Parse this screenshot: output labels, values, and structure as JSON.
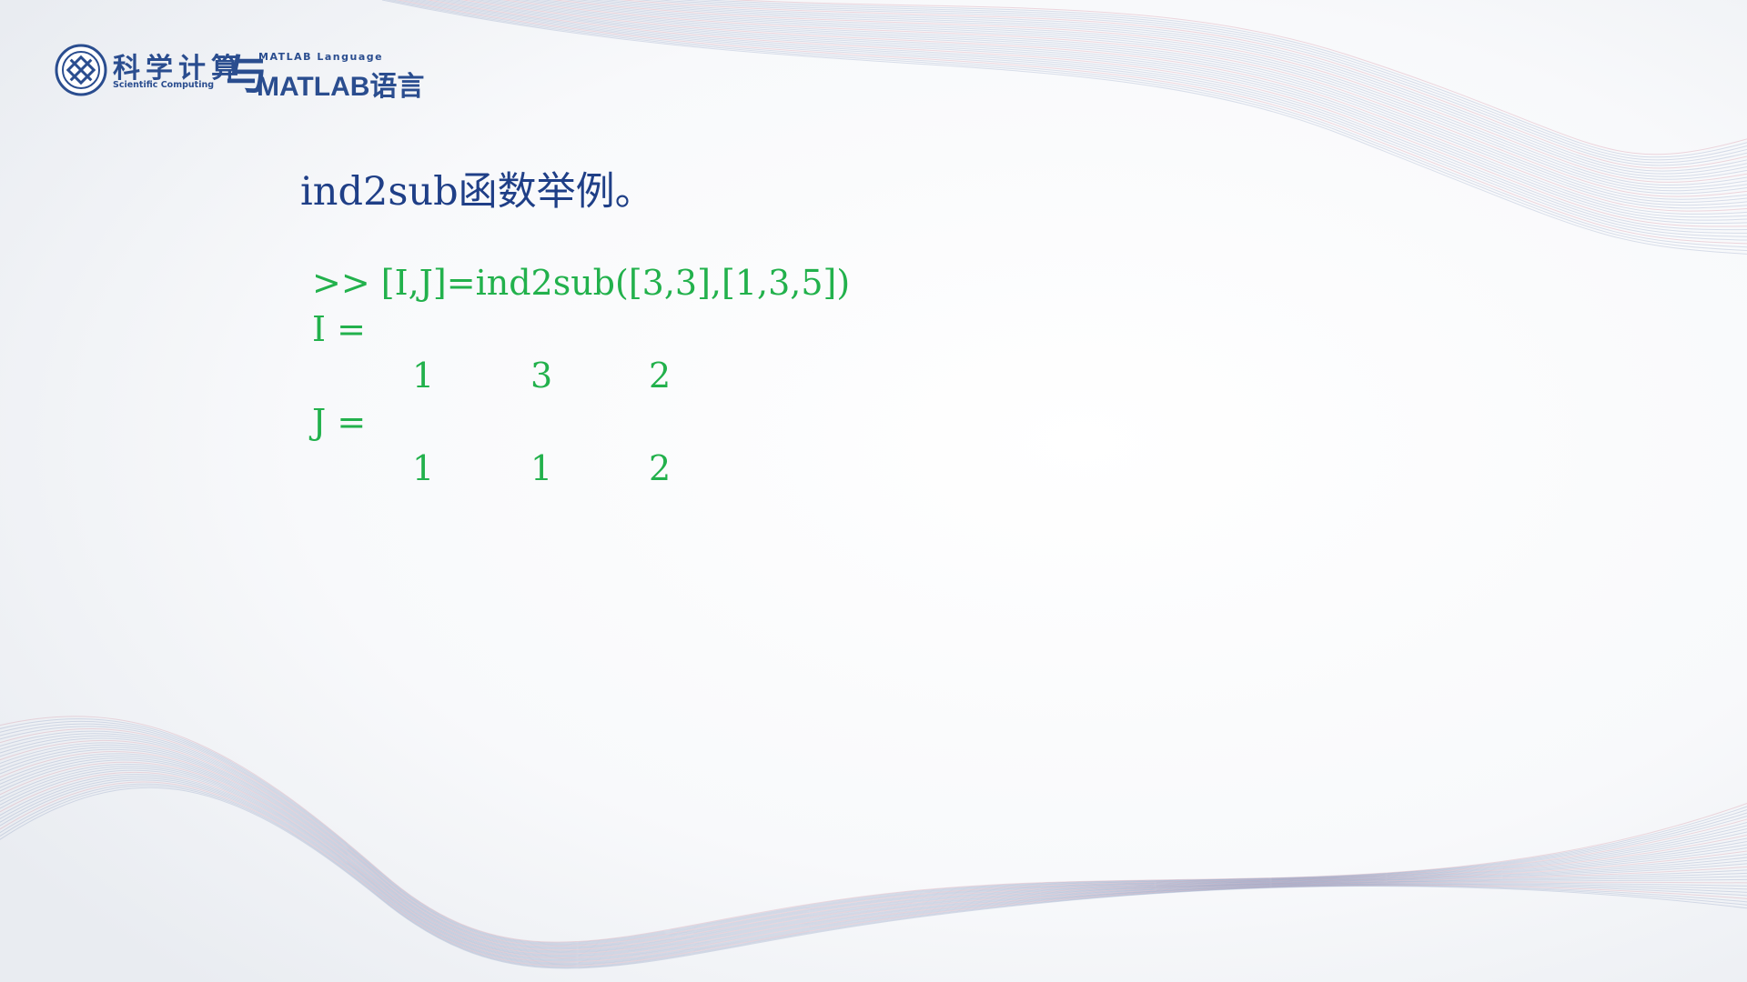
{
  "logo": {
    "title_cn": "科学计算",
    "title_en": "Scientific Computing",
    "connector": "与",
    "subtitle_en": "MATLAB Language",
    "subtitle_big": "MATLAB语言"
  },
  "slide": {
    "heading": "ind2sub函数举例。",
    "command": ">> [I,J]=ind2sub([3,3],[1,3,5])",
    "i_label": "I =",
    "i_values": [
      "1",
      "3",
      "2"
    ],
    "j_label": "J =",
    "j_values": [
      "1",
      "1",
      "2"
    ]
  },
  "colors": {
    "heading": "#1f3f87",
    "code": "#22b14c",
    "logo": "#2a4d8f"
  }
}
